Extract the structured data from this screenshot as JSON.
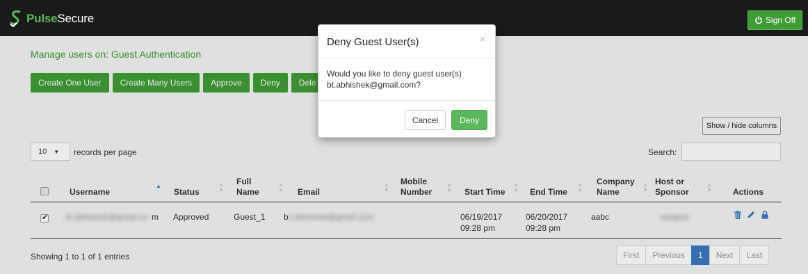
{
  "header": {
    "brand_strong": "Pulse",
    "brand_rest": "Secure",
    "signoff_label": "Sign Off",
    "logo_icon": "pulse-s-logo-icon",
    "signoff_icon": "power-icon"
  },
  "page": {
    "title": "Manage users on: Guest Authentication"
  },
  "toolbar": {
    "buttons": [
      "Create One User",
      "Create Many Users",
      "Approve",
      "Deny",
      "Dele"
    ]
  },
  "table_controls": {
    "show_hide_label": "Show / hide columns",
    "page_length_value": "10",
    "page_length_suffix": "records per page",
    "search_label": "Search:",
    "search_value": ""
  },
  "table": {
    "columns": [
      "Username",
      "Status",
      "Full Name",
      "Email",
      "Mobile Number",
      "Start Time",
      "End Time",
      "Company Name",
      "Host or Sponsor",
      "Actions"
    ],
    "rows": [
      {
        "checked": true,
        "username_visible": "m",
        "status": "Approved",
        "full_name": "Guest_1",
        "email_visible": "b",
        "mobile_number": "",
        "start_time": "06/19/2017 09:28 pm",
        "end_time": "06/20/2017 09:28 pm",
        "company_name": "aabc",
        "action_icons": [
          "trash-icon",
          "pencil-icon",
          "lock-icon"
        ]
      }
    ],
    "info": "Showing 1 to 1 of 1 entries"
  },
  "pagination": {
    "first": "First",
    "previous": "Previous",
    "current": "1",
    "next": "Next",
    "last": "Last"
  },
  "modal": {
    "title": "Deny Guest User(s)",
    "close": "×",
    "message_line1": "Would you like to deny guest user(s)",
    "message_line2": "bt.abhishek@gmail.com?",
    "cancel_label": "Cancel",
    "deny_label": "Deny"
  },
  "colors": {
    "topbar": "#1a1a1a",
    "brand_green": "#3f9c35",
    "deny_green": "#5cb85c",
    "pager_active": "#3a79c0"
  }
}
